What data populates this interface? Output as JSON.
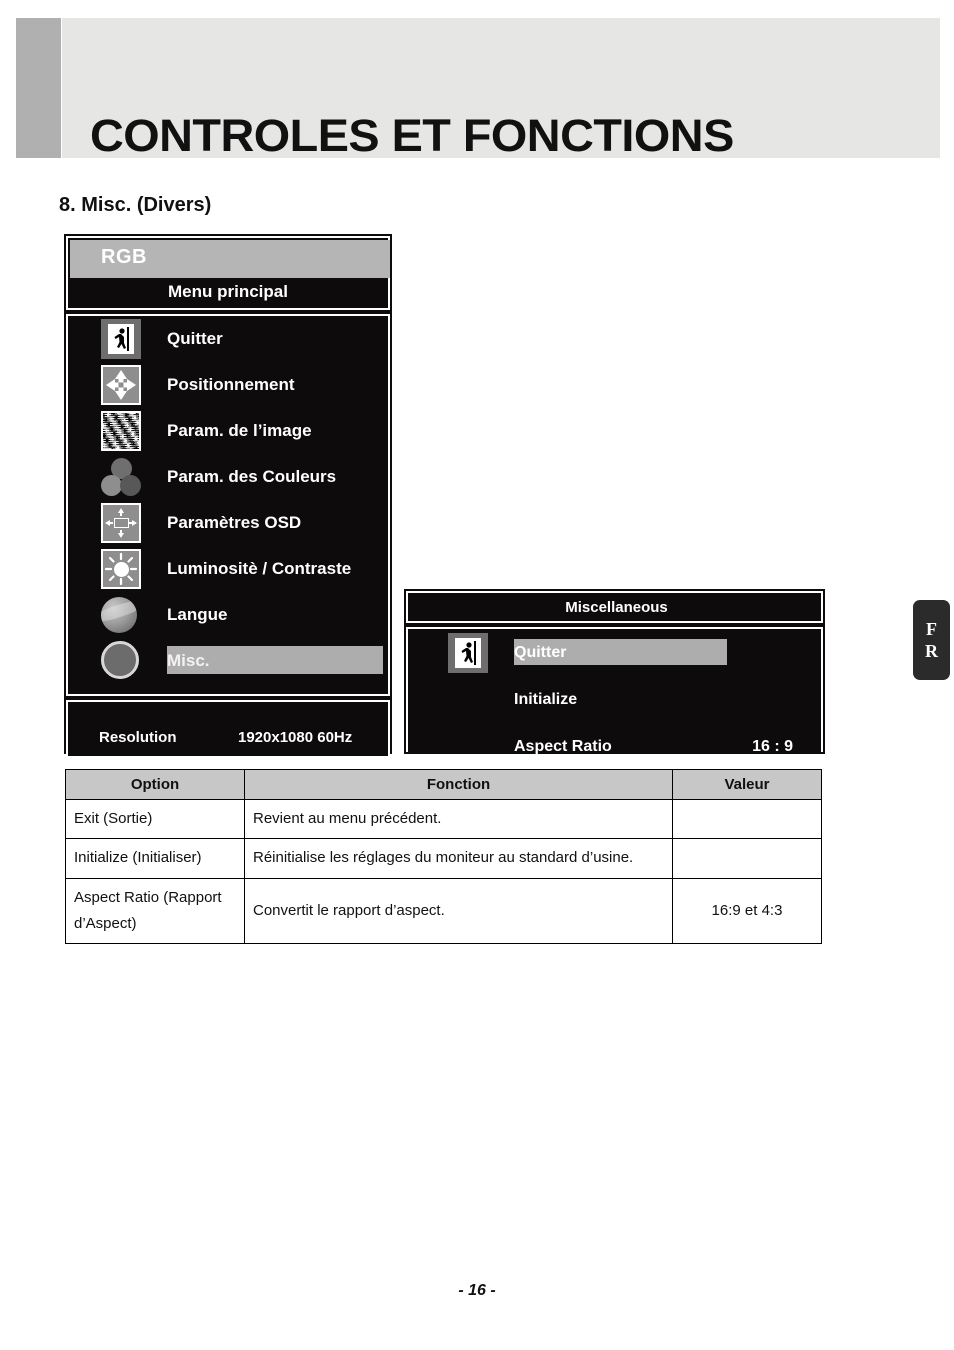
{
  "header": {
    "title": "CONTROLES ET FONCTIONS"
  },
  "section": {
    "heading": "8. Misc. (Divers)"
  },
  "osd_main": {
    "source_label": "RGB",
    "subtitle": "Menu principal",
    "items": [
      {
        "icon": "exit-icon",
        "label": "Quitter",
        "selected": false
      },
      {
        "icon": "move-arrows-icon",
        "label": "Positionnement",
        "selected": false
      },
      {
        "icon": "image-pattern-icon",
        "label": "Param. de l’image",
        "selected": false
      },
      {
        "icon": "color-circles-icon",
        "label": "Param. des Couleurs",
        "selected": false
      },
      {
        "icon": "osd-position-icon",
        "label": "Paramètres OSD",
        "selected": false
      },
      {
        "icon": "brightness-icon",
        "label": "Luminositè / Contraste",
        "selected": false
      },
      {
        "icon": "globe-icon",
        "label": "Langue",
        "selected": false
      },
      {
        "icon": "misc-circle-icon",
        "label": "Misc.",
        "selected": true
      }
    ],
    "footer": {
      "resolution_label": "Resolution",
      "resolution_value": "1920x1080 60Hz"
    }
  },
  "osd_misc": {
    "title": "Miscellaneous",
    "items": [
      {
        "icon": "exit-icon",
        "label": "Quitter",
        "value": "",
        "selected": true
      },
      {
        "icon": "",
        "label": "Initialize",
        "value": "",
        "selected": false
      },
      {
        "icon": "",
        "label": "Aspect Ratio",
        "value": "16 : 9",
        "selected": false
      }
    ]
  },
  "side_tab": {
    "line1": "F",
    "line2": "R"
  },
  "table": {
    "headers": [
      "Option",
      "Fonction",
      "Valeur"
    ],
    "rows": [
      {
        "option": "Exit (Sortie)",
        "fonction": "Revient au menu précédent.",
        "valeur": ""
      },
      {
        "option": "Initialize (Initialiser)",
        "fonction": "Réinitialise les réglages du moniteur au standard d’usine.",
        "valeur": ""
      },
      {
        "option": "Aspect Ratio (Rapport d’Aspect)",
        "fonction": "Convertit le rapport d’aspect.",
        "valeur": "16:9 et 4:3"
      }
    ]
  },
  "footer": {
    "page_number": "- 16 -"
  },
  "colors": {
    "header_panel": "#e6e6e4",
    "header_accent": "#b0b0b0",
    "osd_background": "#0d0b0b",
    "osd_highlight": "#adadad",
    "osd_band": "#b5b5b5",
    "table_header": "#c7c7c7",
    "side_tab": "#2b2b2b"
  }
}
